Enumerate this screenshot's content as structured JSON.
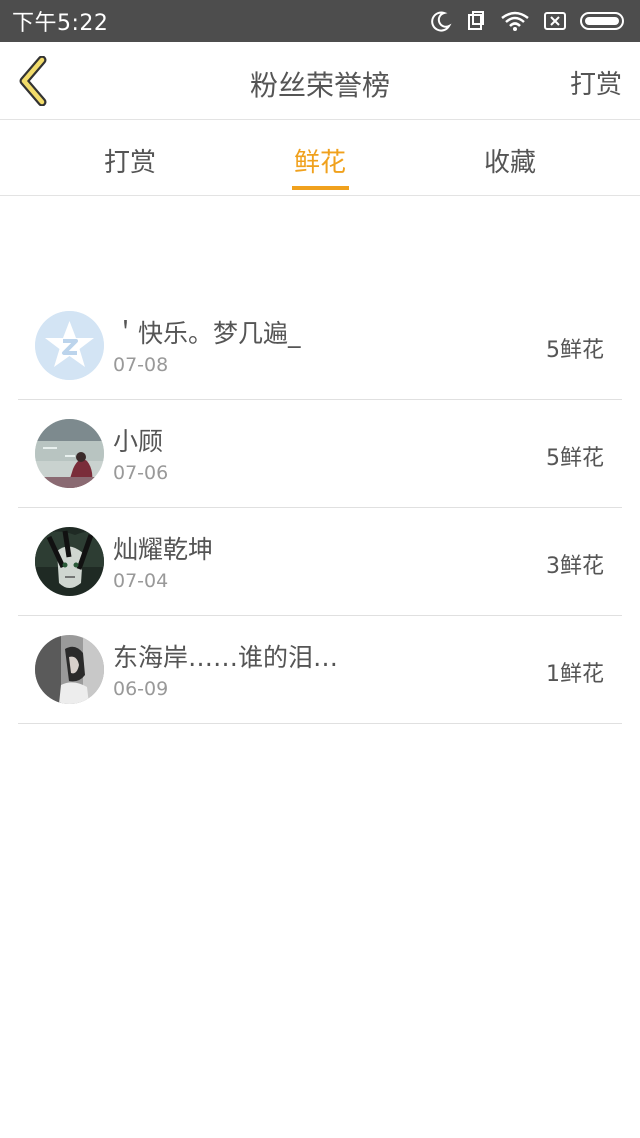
{
  "status_bar": {
    "time": "下午5:22"
  },
  "header": {
    "title": "粉丝荣誉榜",
    "right_link": "打赏"
  },
  "tabs": [
    {
      "label": "打赏",
      "active": false
    },
    {
      "label": "鲜花",
      "active": true
    },
    {
      "label": "收藏",
      "active": false
    }
  ],
  "accent_color": "#f0a11d",
  "list": [
    {
      "name": "＇快乐。梦几遍_",
      "date": "07-08",
      "count": "5鲜花",
      "avatar": "qq-star-icon"
    },
    {
      "name": "小顾",
      "date": "07-06",
      "count": "5鲜花",
      "avatar": "photo"
    },
    {
      "name": "灿耀乾坤",
      "date": "07-04",
      "count": "3鲜花",
      "avatar": "photo"
    },
    {
      "name": "东海岸……谁的泪…",
      "date": "06-09",
      "count": "1鲜花",
      "avatar": "photo"
    }
  ]
}
